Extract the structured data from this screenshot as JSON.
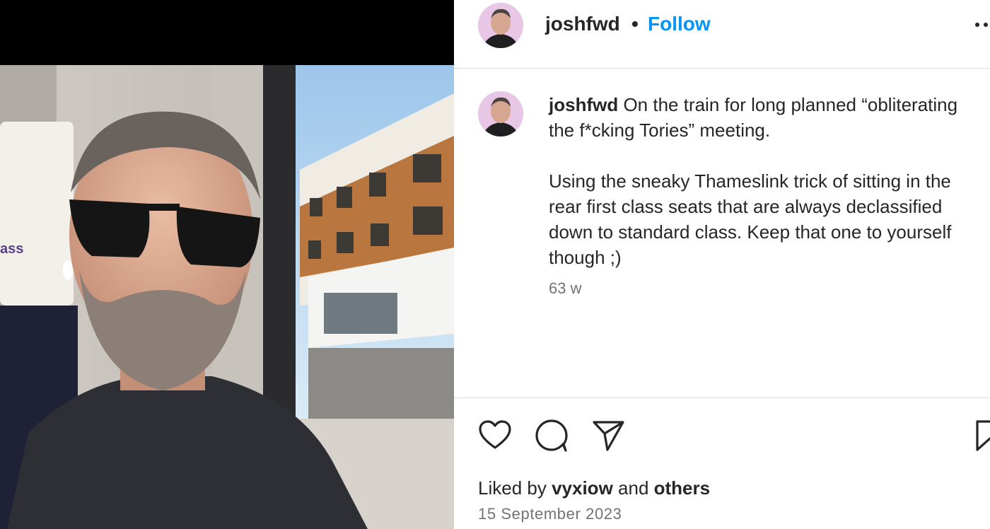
{
  "post": {
    "username": "joshfwd",
    "separator": "•",
    "follow_label": "Follow",
    "caption_username": "joshfwd",
    "caption_line1": " On the train for long planned “obliterating the f*cking Tories” meeting.",
    "caption_para2": "Using the sneaky Thameslink trick of sitting in the rear first class seats that are always declassified down to standard class. Keep that one to yourself though ;)",
    "caption_age": "63 w",
    "liked_by_prefix": "Liked by ",
    "liked_by_user": "vyxiow",
    "liked_by_and": " and ",
    "liked_by_others": "others",
    "date": "15 September 2023"
  },
  "photo": {
    "seat_label": "ass"
  },
  "icons": {
    "more": "more-options-icon",
    "like": "heart-icon",
    "comment": "comment-icon",
    "share": "paper-plane-icon",
    "save": "bookmark-icon"
  },
  "colors": {
    "follow": "#0095f6",
    "avatar_bg": "#e8c6e6",
    "secondary_text": "#737373"
  }
}
